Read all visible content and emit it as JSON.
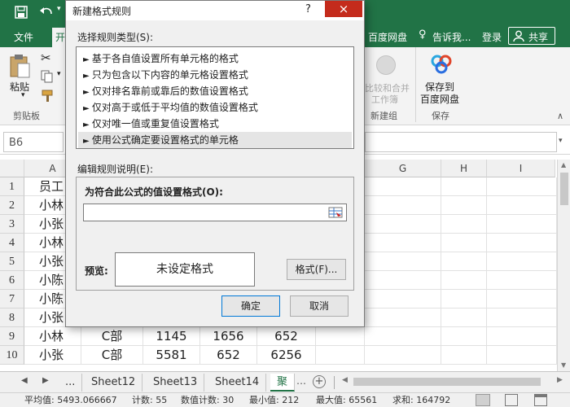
{
  "ribbon_tabs": {
    "file": "文件",
    "home_partial": "开",
    "baidu": "百度网盘",
    "tell_me": "告诉我...",
    "login": "登录",
    "share": "共享"
  },
  "ribbon": {
    "paste": "粘贴",
    "clipboard": "剪贴板",
    "compare_merge_1": "比较和合并",
    "compare_merge_2": "工作簿",
    "new_group": "新建组",
    "save_baidu_1": "保存到",
    "save_baidu_2": "百度网盘",
    "save_group": "保存"
  },
  "name_box": "B6",
  "columns": {
    "A": "A",
    "G": "G",
    "H": "H",
    "I": "I"
  },
  "rows": [
    {
      "num": "1",
      "a": "员工"
    },
    {
      "num": "2",
      "a": "小林"
    },
    {
      "num": "3",
      "a": "小张"
    },
    {
      "num": "4",
      "a": "小林"
    },
    {
      "num": "5",
      "a": "小张"
    },
    {
      "num": "6",
      "a": "小陈"
    },
    {
      "num": "7",
      "a": "小陈"
    },
    {
      "num": "8",
      "a": "小张"
    },
    {
      "num": "9",
      "a": "小林",
      "b": "C部",
      "c": "1145",
      "d": "1656",
      "e": "652"
    },
    {
      "num": "10",
      "a": "小张",
      "b": "C部",
      "c": "5581",
      "d": "652",
      "e": "6256"
    }
  ],
  "sheet_tabs": [
    "...",
    "Sheet12",
    "Sheet13",
    "Sheet14",
    "聚"
  ],
  "status": {
    "average": "平均值: 5493.066667",
    "count": "计数: 55",
    "num_count": "数值计数: 30",
    "min": "最小值: 212",
    "max": "最大值: 65561",
    "sum": "求和: 164792"
  },
  "dialog": {
    "title": "新建格式规则",
    "help": "?",
    "close": "×",
    "select_type_label": "选择规则类型(S):",
    "rule_types": [
      "基于各自值设置所有单元格的格式",
      "只为包含以下内容的单元格设置格式",
      "仅对排名靠前或靠后的数值设置格式",
      "仅对高于或低于平均值的数值设置格式",
      "仅对唯一值或重复值设置格式",
      "使用公式确定要设置格式的单元格"
    ],
    "selected_index": 5,
    "edit_desc_label": "编辑规则说明(E):",
    "formula_label": "为符合此公式的值设置格式(O):",
    "formula_value": "",
    "preview_label": "预览:",
    "preview_text": "未设定格式",
    "format_button": "格式(F)...",
    "ok": "确定",
    "cancel": "取消"
  }
}
